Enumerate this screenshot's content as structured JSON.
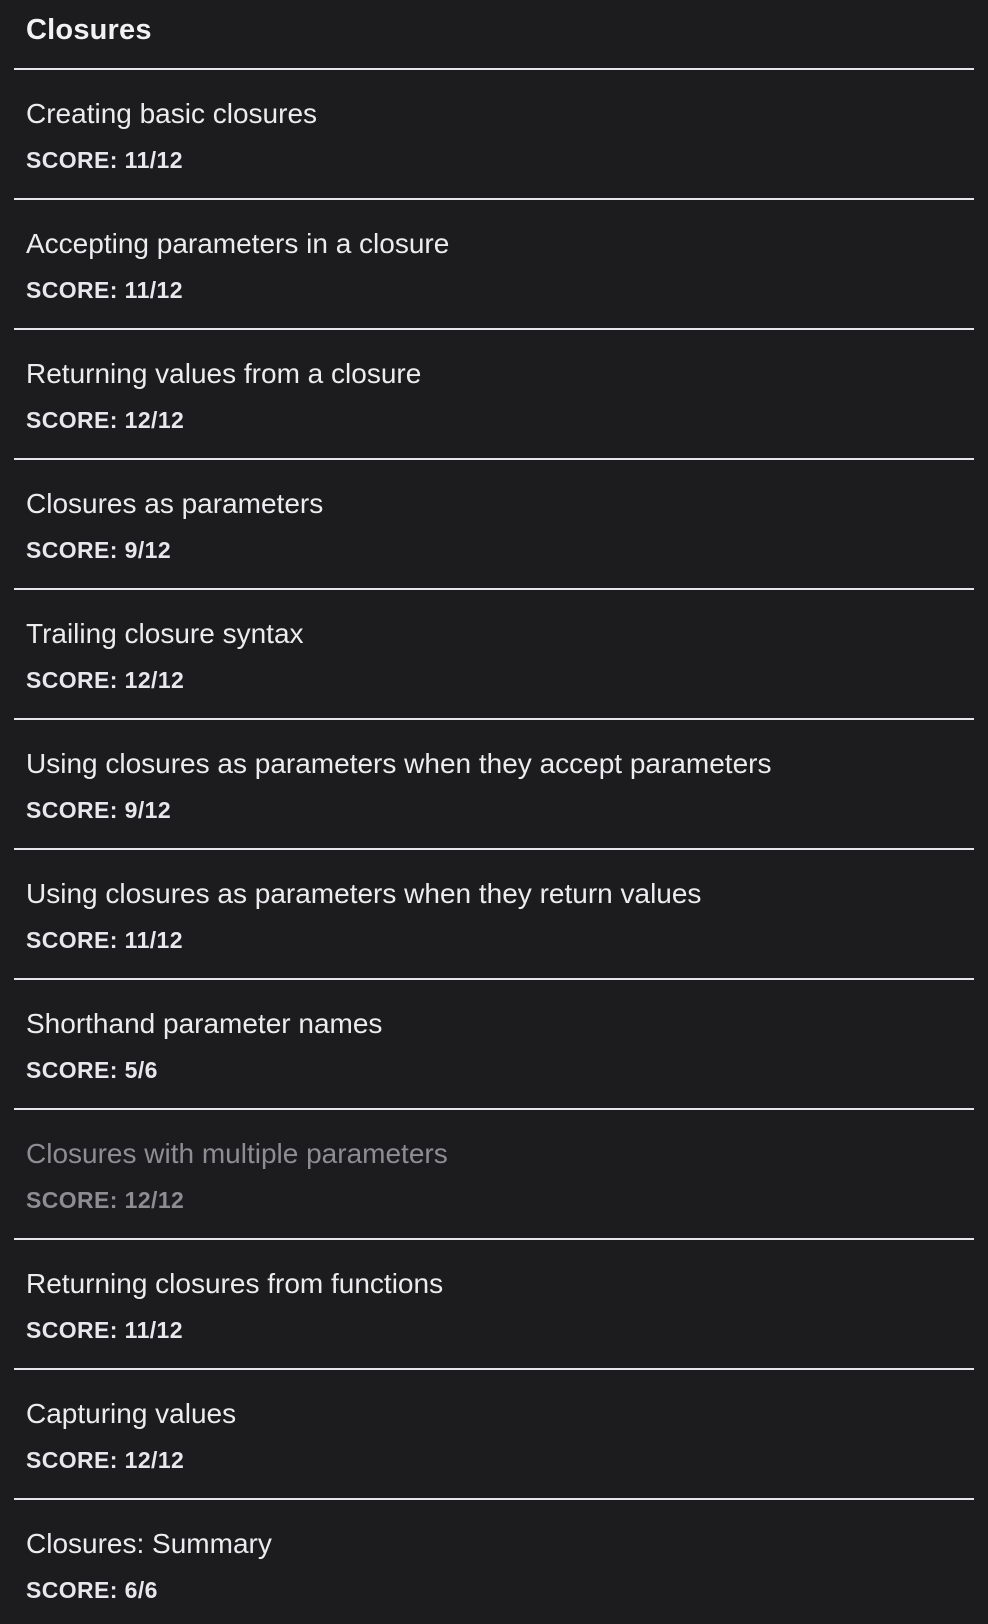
{
  "header": {
    "title": "Closures"
  },
  "items": [
    {
      "title": "Creating basic closures",
      "score": "SCORE: 11/12",
      "dimmed": false
    },
    {
      "title": "Accepting parameters in a closure",
      "score": "SCORE: 11/12",
      "dimmed": false
    },
    {
      "title": "Returning values from a closure",
      "score": "SCORE: 12/12",
      "dimmed": false
    },
    {
      "title": "Closures as parameters",
      "score": "SCORE: 9/12",
      "dimmed": false
    },
    {
      "title": "Trailing closure syntax",
      "score": "SCORE: 12/12",
      "dimmed": false
    },
    {
      "title": "Using closures as parameters when they accept parameters",
      "score": "SCORE: 9/12",
      "dimmed": false
    },
    {
      "title": "Using closures as parameters when they return values",
      "score": "SCORE: 11/12",
      "dimmed": false
    },
    {
      "title": "Shorthand parameter names",
      "score": "SCORE: 5/6",
      "dimmed": false
    },
    {
      "title": "Closures with multiple parameters",
      "score": "SCORE: 12/12",
      "dimmed": true
    },
    {
      "title": "Returning closures from functions",
      "score": "SCORE: 11/12",
      "dimmed": false
    },
    {
      "title": "Capturing values",
      "score": "SCORE: 12/12",
      "dimmed": false
    },
    {
      "title": "Closures: Summary",
      "score": "SCORE: 6/6",
      "dimmed": false
    }
  ],
  "colors": {
    "background": "#1c1c1e",
    "text": "#ececef",
    "dimmed_text": "#8d8d92",
    "divider": "#e6e6ea"
  }
}
